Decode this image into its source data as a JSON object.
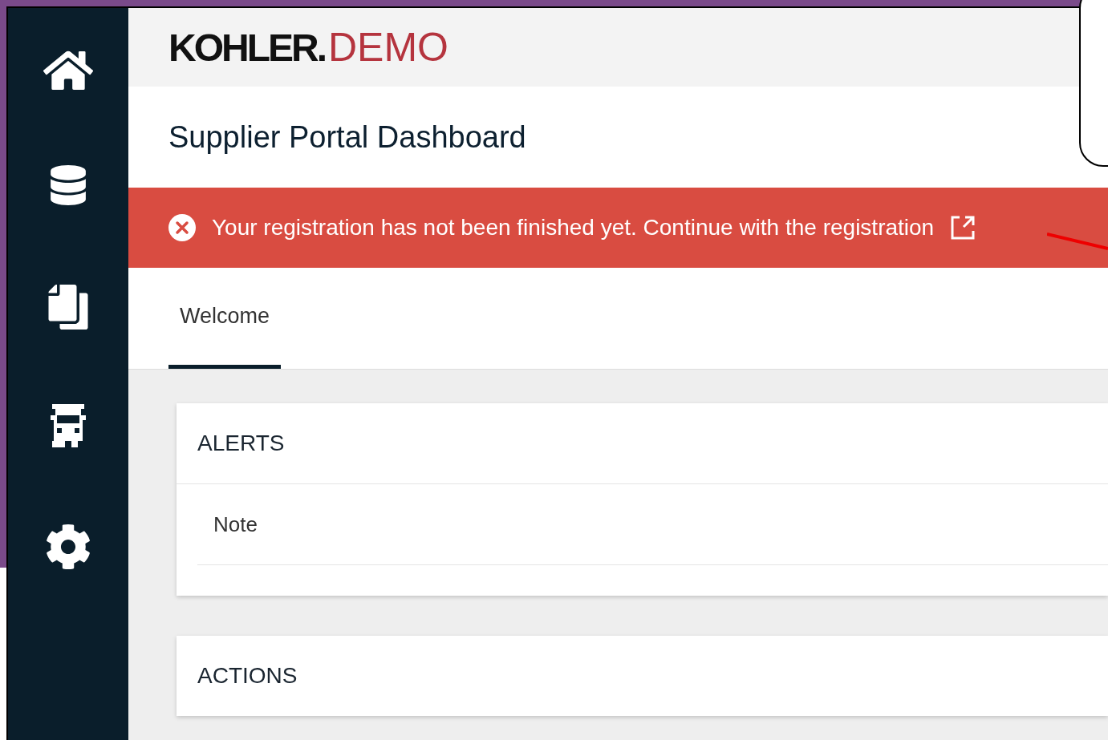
{
  "sidebar": {
    "items": [
      {
        "kind": "home"
      },
      {
        "kind": "database"
      },
      {
        "kind": "documents"
      },
      {
        "kind": "truck"
      },
      {
        "kind": "settings"
      }
    ]
  },
  "header": {
    "brand": "KOHLER.",
    "suffix": "DEMO"
  },
  "page_title": "Supplier Portal Dashboard",
  "banner": {
    "message": "Your registration has not been finished yet. Continue with the registration"
  },
  "tabs": [
    {
      "label": "Welcome",
      "selected": true
    }
  ],
  "cards": [
    {
      "title": "ALERTS",
      "rows": [
        "Note"
      ]
    },
    {
      "title": "ACTIONS"
    }
  ]
}
